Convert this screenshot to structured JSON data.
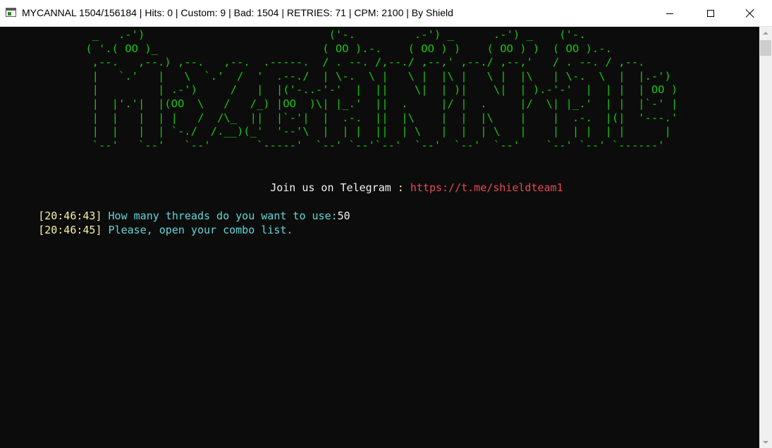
{
  "window": {
    "title": "MYCANNAL 1504/156184 | Hits: 0 | Custom: 9 | Bad: 1504 | RETRIES: 71 | CPM: 2100 | By Shield",
    "icon": "console-app-icon",
    "controls": {
      "minimize": "minimize-icon",
      "maximize": "maximize-icon",
      "close": "close-icon"
    }
  },
  "console": {
    "banner": "              _   .-')                            ('-.         .-') _      .-') _    ('-.            \n             ( '.( OO )_                         ( OO ).-.    ( OO ) )    ( OO ) )  ( OO ).-.        \n              ,--.   ,--.) ,--.   ,--.  .-----.  / . --. /,--./ ,--,' ,--./ ,--,'   / . --. / ,--.    \n              |   `.'   |   \\  `.'  /  '  .--./  | \\-.  \\ |   \\ |  |\\ |   \\ |  |\\   | \\-.  \\  |  |.-') \n              |         | .-')     /   |  |('-..-'-'  |  ||    \\|  | )|    \\|  | ).-'-'  |  | |  | OO )\n              |  |'.'|  |(OO  \\   /   /_) |OO  )\\| |_.'  ||  .     |/ |  .     |/  \\| |_.'  | |  |`-' |\n              |  |   |  | |   /  /\\_  ||  |`-'|  |  .-.  ||  |\\    |  |  |\\    |    |  .-.  |(|  '---.'\n              |  |   |  | `-./  /.__)(_'  '--'\\  |  | |  ||  | \\   |  |  | \\   |    |  | |  | |      | \n              `--'   `--'   `--'       `-----'  `--' `--'`--'  `--'  `--'  `--'    `--' `--' `------' ",
    "telegram": {
      "label": "Join us on Telegram",
      "separator": " : ",
      "link": "https://t.me/shieldteam1"
    },
    "log": [
      {
        "timestamp": "[20:46:43]",
        "message": " How many threads do you want to use:",
        "value": "50"
      },
      {
        "timestamp": "[20:46:45]",
        "message": " Please, open your combo list.",
        "value": ""
      }
    ]
  },
  "colors": {
    "banner": "#16c60c",
    "timestamp": "#f9f1a5",
    "message": "#61d6d6",
    "link": "#e74856",
    "background": "#0c0c0c"
  }
}
